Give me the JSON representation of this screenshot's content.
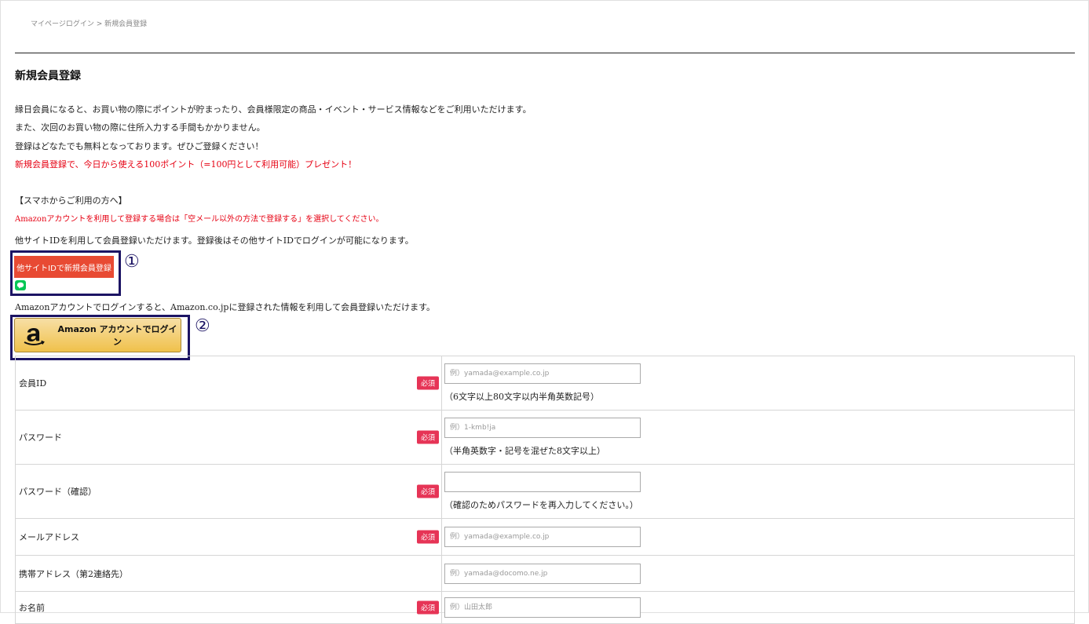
{
  "breadcrumb": {
    "home": "マイページログイン",
    "sep": ">",
    "current": "新規会員登録"
  },
  "page_title": "新規会員登録",
  "intro": {
    "line1": "縁日会員になると、お買い物の際にポイントが貯まったり、会員様限定の商品・イベント・サービス情報などをご利用いただけます。",
    "line2": "また、次回のお買い物の際に住所入力する手間もかかりません。",
    "line3": "登録はどなたでも無料となっております。ぜひご登録ください！",
    "promo": "新規会員登録で、今日から使える100ポイント（=100円として利用可能）プレゼント！"
  },
  "smartphone": {
    "heading": "【スマホからご利用の方へ】",
    "note": "Amazonアカウントを利用して登録する場合は「空メール以外の方法で登録する」を選択してください。"
  },
  "social": {
    "text": "他サイトIDを利用して会員登録いただけます。登録後はその他サイトIDでログインが可能になります。",
    "button_label": "他サイトIDで新規会員登録",
    "callout": "①"
  },
  "amazon": {
    "text": "Amazonアカウントでログインすると、Amazon.co.jpに登録された情報を利用して会員登録いただけます。",
    "button_label": "Amazon アカウントでログイン",
    "callout": "②"
  },
  "form": {
    "required_label": "必須",
    "rows": [
      {
        "label": "会員ID",
        "placeholder": "例）yamada@example.co.jp",
        "hint": "（6文字以上80文字以内半角英数記号）"
      },
      {
        "label": "パスワード",
        "placeholder": "例）1-kmb!ja",
        "hint": "（半角英数字・記号を混ぜた8文字以上）"
      },
      {
        "label": "パスワード（確認）",
        "placeholder": "",
        "hint": "（確認のためパスワードを再入力してください。）"
      },
      {
        "label": "メールアドレス",
        "placeholder": "例）yamada@example.co.jp"
      },
      {
        "label": "携帯アドレス（第2連絡先）",
        "placeholder": "例）yamada@docomo.ne.jp"
      },
      {
        "label": "お名前",
        "placeholder": "例）山田太郎"
      }
    ]
  },
  "colors": {
    "accent_red": "#e60012",
    "badge": "#e63456",
    "highlight_frame": "#1c1464",
    "social_button": "#e84a33",
    "amazon_button": "#f0c14b",
    "line_green": "#06c755"
  }
}
